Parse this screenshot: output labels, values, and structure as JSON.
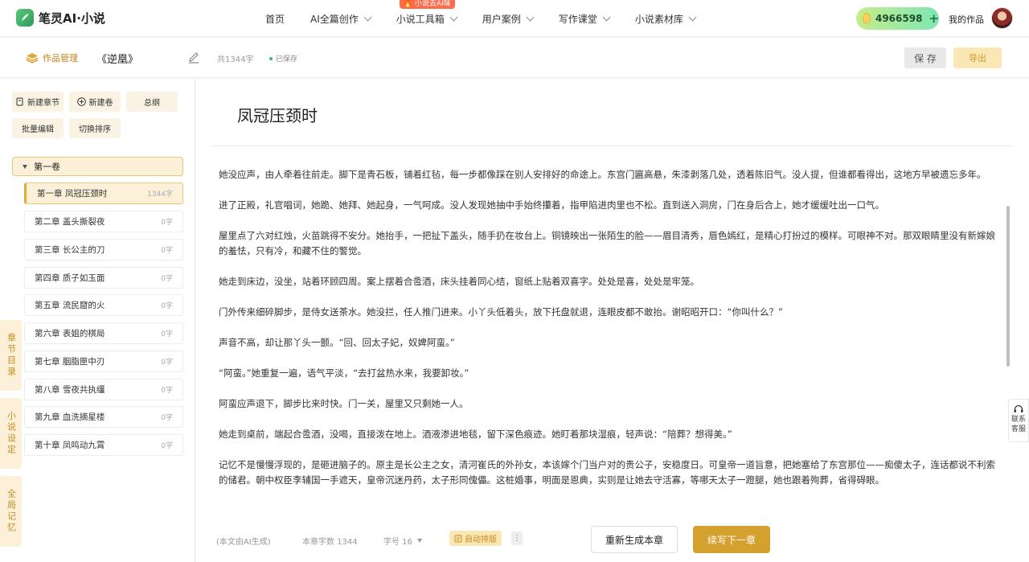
{
  "nav": {
    "logo_text": "笔灵AI·小说",
    "items": [
      {
        "label": "首页",
        "has_dropdown": false
      },
      {
        "label": "AI全篇创作",
        "has_dropdown": true
      },
      {
        "label": "小说工具箱",
        "has_dropdown": true,
        "badge": "小说去AI味"
      },
      {
        "label": "用户案例",
        "has_dropdown": true
      },
      {
        "label": "写作课堂",
        "has_dropdown": true
      },
      {
        "label": "小说素材库",
        "has_dropdown": true
      }
    ],
    "credits": "4966598",
    "credits_plus": "+",
    "my_works": "我的作品"
  },
  "toolbar": {
    "manage_label": "作品管理",
    "work_title": "《逆凰》",
    "word_count": "共1344字",
    "saved_status": "已保存",
    "save_label": "保 存",
    "export_label": "导出"
  },
  "sidebar": {
    "buttons": {
      "new_chapter": "新建章节",
      "new_volume": "新建卷",
      "outline": "总纲",
      "batch_edit": "批量编辑",
      "sort": "切换排序"
    },
    "volume": "第一卷",
    "chapters": [
      {
        "title": "第一章 凤冠压颈时",
        "words": "1344字"
      },
      {
        "title": "第二章 盖头撕裂夜",
        "words": "0字"
      },
      {
        "title": "第三章 长公主的刀",
        "words": "0字"
      },
      {
        "title": "第四章 质子如玉面",
        "words": "0字"
      },
      {
        "title": "第五章 流民窟的火",
        "words": "0字"
      },
      {
        "title": "第六章 表姐的棋局",
        "words": "0字"
      },
      {
        "title": "第七章 胭脂匣中刃",
        "words": "0字"
      },
      {
        "title": "第八章 雪夜共执缰",
        "words": "0字"
      },
      {
        "title": "第九章 血洗摘星楼",
        "words": "0字"
      },
      {
        "title": "第十章 凤鸣动九霄",
        "words": "0字"
      }
    ],
    "side_tabs": [
      "章节目录",
      "小说设定",
      "全局记忆"
    ]
  },
  "main": {
    "chapter_title": "凤冠压颈时",
    "paragraphs": [
      "她没应声，由人牵着往前走。脚下是青石板，铺着红毡，每一步都像踩在别人安排好的命途上。东宫门匾高悬，朱漆剥落几处，透着陈旧气。没人提，但谁都看得出，这地方早被遗忘多年。",
      "进了正殿，礼官唱词，她跪、她拜、她起身，一气呵成。没人发现她抽中手始终攥着，指甲陷进肉里也不松。直到送入洞房，门在身后合上，她才缓缓吐出一口气。",
      "屋里点了六对红烛，火苗跳得不安分。她抬手，一把扯下盖头，随手扔在妆台上。铜镜映出一张陌生的脸——眉目清秀，唇色嫣红，是精心打扮过的模样。可眼神不对。那双眼睛里没有新嫁娘的羞怯，只有冷，和藏不住的警觉。",
      "她走到床边，没坐，站着环顾四周。案上摆着合卺酒，床头挂着同心结，窗纸上贴着双喜字。处处是喜，处处是牢笼。",
      "门外传来细碎脚步，是侍女送茶水。她没拦，任人推门进来。小丫头低着头，放下托盘就退，连眼皮都不敢抬。谢昭昭开口：“你叫什么？”",
      "声音不高，却让那丫头一颤。“回、回太子妃，奴婢阿蛮。”",
      "“阿蛮。”她重复一遍，语气平淡，“去打盆热水来，我要卸妆。”",
      "阿蛮应声退下，脚步比来时快。门一关，屋里又只剩她一人。",
      "她走到桌前，端起合卺酒，没喝，直接泼在地上。酒液渗进地毯，留下深色痕迹。她盯着那块湿痕，轻声说：“陪葬？想得美。”",
      "记忆不是慢慢浮现的，是砸进脑子的。原主是长公主之女，清河崔氏的外孙女，本该嫁个门当户对的贵公子，安稳度日。可皇帝一道旨意，把她塞给了东宫那位——痴傻太子，连话都说不利索的储君。朝中权臣李辅国一手遮天，皇帝沉迷丹药，太子形同傀儡。这桩婚事，明面是恩典，实则是让她去守活寡，等哪天太子一蹬腿，她也跟着殉葬，省得碍眼。"
    ]
  },
  "footer": {
    "ai_note": "(本文由AI生成)",
    "chapter_words": "本章字数 1344",
    "font_size": "字号 16",
    "auto_format": "自动排版",
    "more": "⋮",
    "regenerate": "重新生成本章",
    "continue": "续写下一章"
  },
  "service": {
    "line1": "联系",
    "line2": "客服"
  },
  "colors": {
    "accent": "#d4a02e",
    "accent_light": "#fcf1d8",
    "brand_green": "#3bb36a"
  }
}
